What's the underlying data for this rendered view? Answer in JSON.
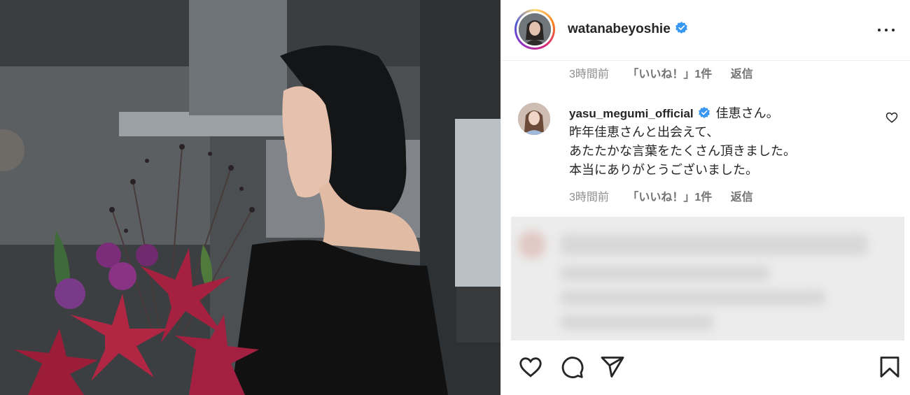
{
  "post": {
    "username": "watanabeyoshie",
    "verified": true
  },
  "previous_comment_meta": {
    "time": "3時間前",
    "likes": "「いいね！」1件",
    "reply": "返信"
  },
  "comment": {
    "username": "yasu_megumi_official",
    "verified": true,
    "lines": [
      "佳恵さん。",
      "昨年佳恵さんと出会えて、",
      "あたたかな言葉をたくさん頂きました。",
      "本当にありがとうございました。"
    ],
    "time": "3時間前",
    "likes": "「いいね！」1件",
    "reply": "返信"
  },
  "icons": {
    "verified": "verified-badge-icon",
    "more": "more-options-icon",
    "like": "heart-icon",
    "comment": "comment-icon",
    "share": "share-icon",
    "save": "bookmark-icon"
  },
  "colors": {
    "verified_blue": "#3897f0",
    "text": "#262626",
    "muted": "#8e8e8e"
  }
}
